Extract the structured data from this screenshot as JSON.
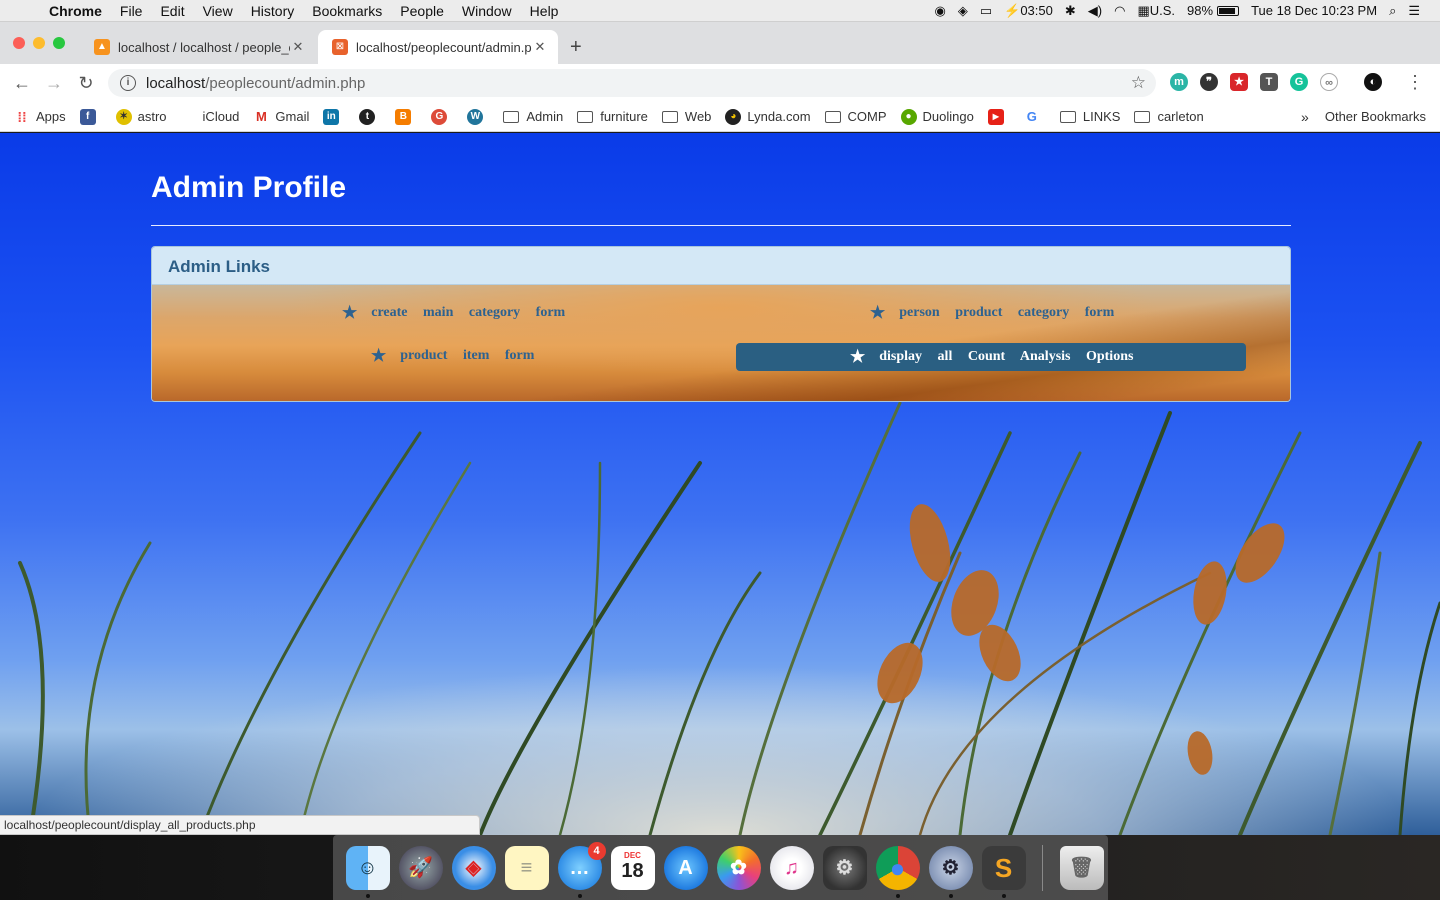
{
  "menubar": {
    "app_name": "Chrome",
    "items": [
      "File",
      "Edit",
      "View",
      "History",
      "Bookmarks",
      "People",
      "Window",
      "Help"
    ],
    "status": {
      "battery_time": "03:50",
      "input_source": "U.S.",
      "battery_percent": "98%",
      "battery_level": 0.98,
      "datetime": "Tue 18 Dec  10:23 PM"
    }
  },
  "tabs": [
    {
      "title": "localhost / localhost / people_c",
      "active": false
    },
    {
      "title": "localhost/peoplecount/admin.p",
      "active": true
    }
  ],
  "toolbar": {
    "url_host": "localhost",
    "url_path": "/peoplecount/admin.php"
  },
  "bookmarks": {
    "items": [
      {
        "label": "Apps",
        "icon": "apps-grid-icon"
      },
      {
        "label": "",
        "icon": "facebook-icon"
      },
      {
        "label": "astro",
        "icon": "astro-icon"
      },
      {
        "label": "iCloud",
        "icon": "apple-icon"
      },
      {
        "label": "Gmail",
        "icon": "gmail-icon"
      },
      {
        "label": "",
        "icon": "linkedin-icon"
      },
      {
        "label": "",
        "icon": "tumblr-icon"
      },
      {
        "label": "",
        "icon": "blogger-icon"
      },
      {
        "label": "",
        "icon": "google-plus-icon"
      },
      {
        "label": "",
        "icon": "wordpress-icon"
      },
      {
        "label": "Admin",
        "icon": "folder-icon"
      },
      {
        "label": "furniture",
        "icon": "folder-icon"
      },
      {
        "label": "Web",
        "icon": "folder-icon"
      },
      {
        "label": "Lynda.com",
        "icon": "lynda-icon"
      },
      {
        "label": "COMP",
        "icon": "folder-icon"
      },
      {
        "label": "Duolingo",
        "icon": "duolingo-icon"
      },
      {
        "label": "",
        "icon": "youtube-icon"
      },
      {
        "label": "",
        "icon": "google-icon"
      },
      {
        "label": "LINKS",
        "icon": "folder-icon"
      },
      {
        "label": "carleton",
        "icon": "folder-icon"
      }
    ],
    "overflow": "»",
    "other": "Other Bookmarks"
  },
  "page": {
    "title": "Admin Profile",
    "panel_heading": "Admin Links",
    "links": [
      {
        "label": "create main category form"
      },
      {
        "label": "person product category form"
      },
      {
        "label": "product item form"
      },
      {
        "label": "display all Count Analysis Options"
      }
    ]
  },
  "status_bar": "localhost/peoplecount/display_all_products.php",
  "dock": {
    "apps": [
      "Finder",
      "Launchpad",
      "Safari",
      "Notes",
      "Messages",
      "Calendar",
      "App Store",
      "Photos",
      "iTunes",
      "System Preferences",
      "Chrome",
      "Utilities",
      "Sublime Text",
      "Trash"
    ],
    "messages_badge": "4",
    "calendar_month": "DEC",
    "calendar_day": "18"
  },
  "colors": {
    "panel_heading_bg": "#d4e8f6",
    "panel_heading_text": "#2c5e86",
    "link_text": "#2d6290",
    "active_link_bg": "#2a5f82",
    "page_bg_top": "#0a3be8"
  }
}
